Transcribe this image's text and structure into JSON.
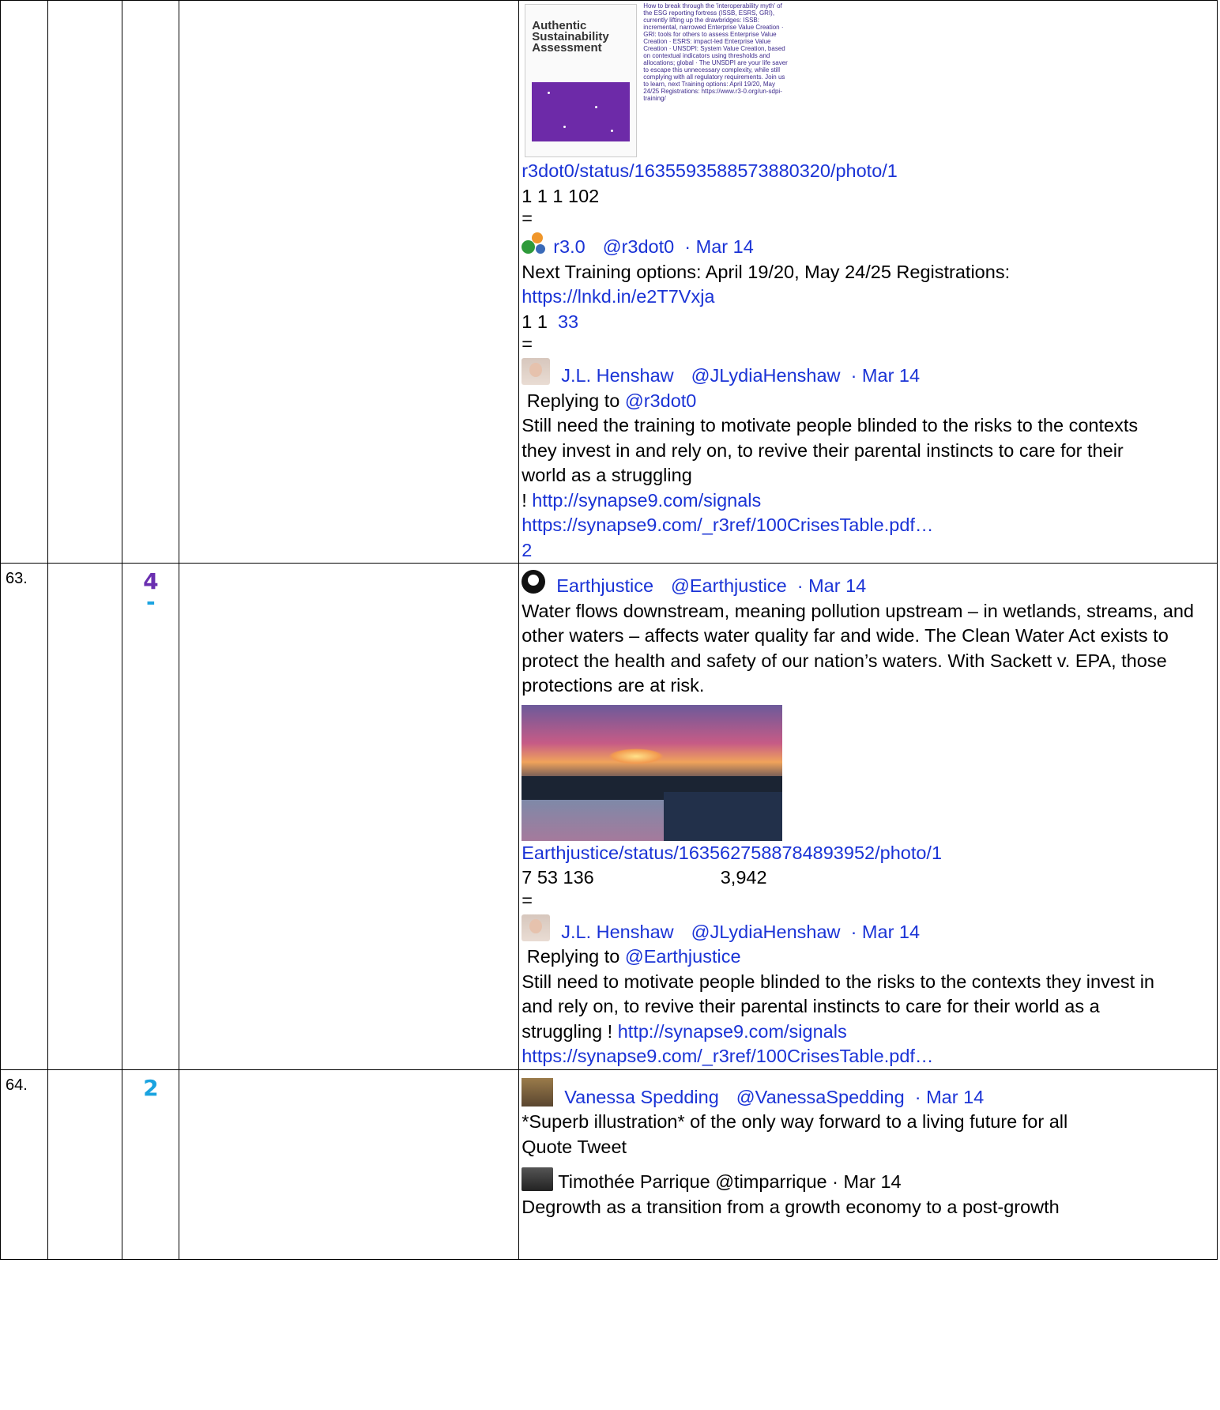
{
  "rows": [
    {
      "num": "",
      "digit": "",
      "tweets": {
        "book": {
          "cover_title": "Authentic Sustainability Assessment",
          "side_text": "How to break through the 'interoperability myth' of the ESG reporting fortress (ISSB, ESRS, GRI), currently lifting up the drawbridges: ISSB: incremental, narrowed Enterprise Value Creation · GRI: tools for others to assess Enterprise Value Creation · ESRS: impact-led Enterprise Value Creation · UNSDPI: System Value Creation, based on contextual indicators using thresholds and allocations; global · The UNSDPI are your life saver to escape this unnecessary complexity, while still complying with all regulatory requirements. Join us to learn, next Training options: April 19/20, May 24/25 Registrations: https://www.r3-0.org/un-sdpi-training/"
        },
        "photo_link": "r3dot0/status/1635593588573880320/photo/1",
        "stats1": "1 1 1 102",
        "eq1": "=",
        "r3": {
          "name": "r3.0",
          "handle": "@r3dot0",
          "date": "· Mar 14",
          "text": "Next Training options: April 19/20, May 24/25 Registrations:",
          "link": "https://lnkd.in/e2T7Vxja",
          "stats": "1 1",
          "stats_link": "33"
        },
        "eq2": "=",
        "jlh": {
          "name": "J.L. Henshaw",
          "handle": "@JLydiaHenshaw",
          "date": "· Mar 14",
          "replying": "Replying to",
          "replying_to": "@r3dot0",
          "text": "Still need the training to motivate people blinded to the risks to the contexts they invest in and rely on, to revive their parental instincts to care for their world as a struggling",
          "excl": "!",
          "link1": "http://synapse9.com/signals",
          "link2": "https://synapse9.com/_r3ref/100CrisesTable.pdf…",
          "stats": "2"
        }
      }
    },
    {
      "num": "63.",
      "digit": "4",
      "digit_sub": "-",
      "digit_color": "#6a2fb0",
      "tweets": {
        "ej": {
          "name": "Earthjustice",
          "handle": "@Earthjustice",
          "date": "· Mar 14",
          "text": "Water flows downstream, meaning pollution upstream – in wetlands, streams, and other waters – affects water quality far and wide. The Clean Water Act exists to protect the health and safety of our nation’s waters. With Sackett v. EPA, those protections are at risk.",
          "photo_link": "Earthjustice/status/1635627588784893952/photo/1",
          "stats": "7 53 136",
          "views": "3,942"
        },
        "eq": "=",
        "jlh": {
          "name": "J.L. Henshaw",
          "handle": "@JLydiaHenshaw",
          "date": "· Mar 14",
          "replying": "Replying to",
          "replying_to": "@Earthjustice",
          "text": "Still need to motivate people blinded to the risks to the contexts they invest in and rely on, to revive their parental instincts to care for their world as a struggling !",
          "link1": "http://synapse9.com/signals",
          "link2": "https://synapse9.com/_r3ref/100CrisesTable.pdf…"
        }
      }
    },
    {
      "num": "64.",
      "digit": "2",
      "digit_color": "#1aa3e0",
      "tweets": {
        "vs": {
          "name": "Vanessa Spedding",
          "handle": "@VanessaSpedding",
          "date": "· Mar 14",
          "text": "*Superb illustration* of the only way forward to a living future for all",
          "quote_label": "Quote Tweet"
        },
        "tp": {
          "header": "Timothée Parrique @timparrique · Mar 14",
          "text": "Degrowth as a transition from a growth economy to a post-growth"
        }
      }
    }
  ]
}
